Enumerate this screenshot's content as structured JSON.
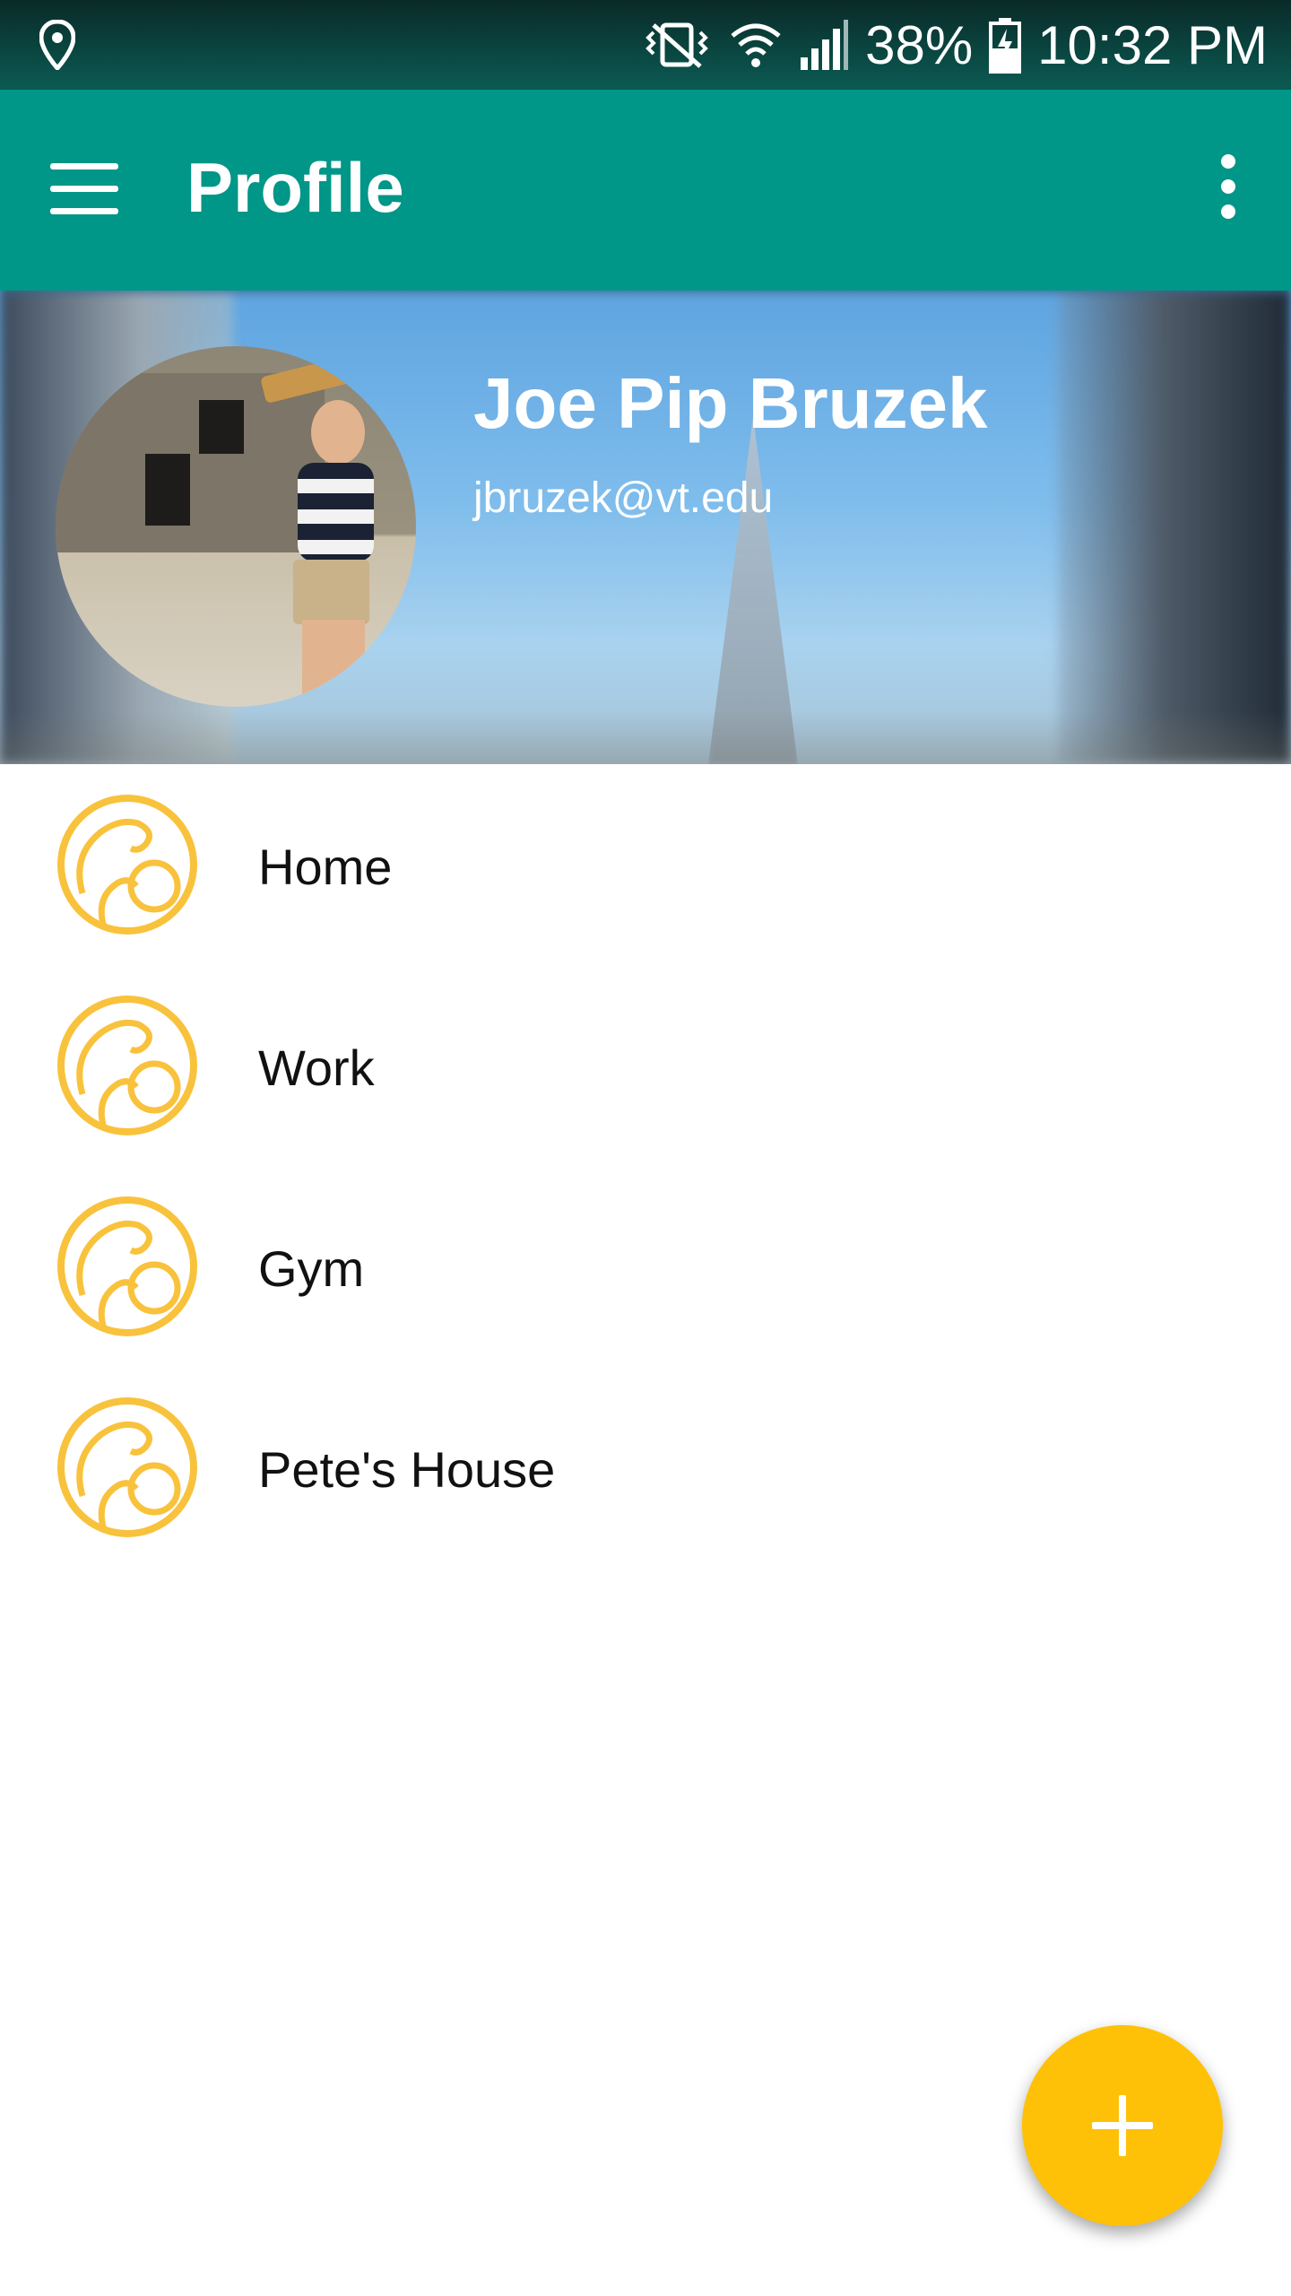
{
  "status_bar": {
    "battery": "38%",
    "time": "10:32 PM",
    "icons": [
      "location-icon",
      "vibrate-mute-icon",
      "wifi-icon",
      "signal-icon",
      "battery-charging-icon"
    ]
  },
  "app_bar": {
    "title": "Profile",
    "menu_icon": "hamburger-menu-icon",
    "more_icon": "more-vertical-icon",
    "color": "#009688"
  },
  "profile": {
    "name": "Joe Pip Bruzek",
    "email": "jbruzek@vt.edu"
  },
  "places": [
    {
      "label": "Home",
      "icon": "place-icon"
    },
    {
      "label": "Work",
      "icon": "place-icon"
    },
    {
      "label": "Gym",
      "icon": "place-icon"
    },
    {
      "label": "Pete's House",
      "icon": "place-icon"
    }
  ],
  "fab": {
    "icon": "add-icon",
    "color": "#ffc107"
  },
  "accent": "#f9c23c"
}
